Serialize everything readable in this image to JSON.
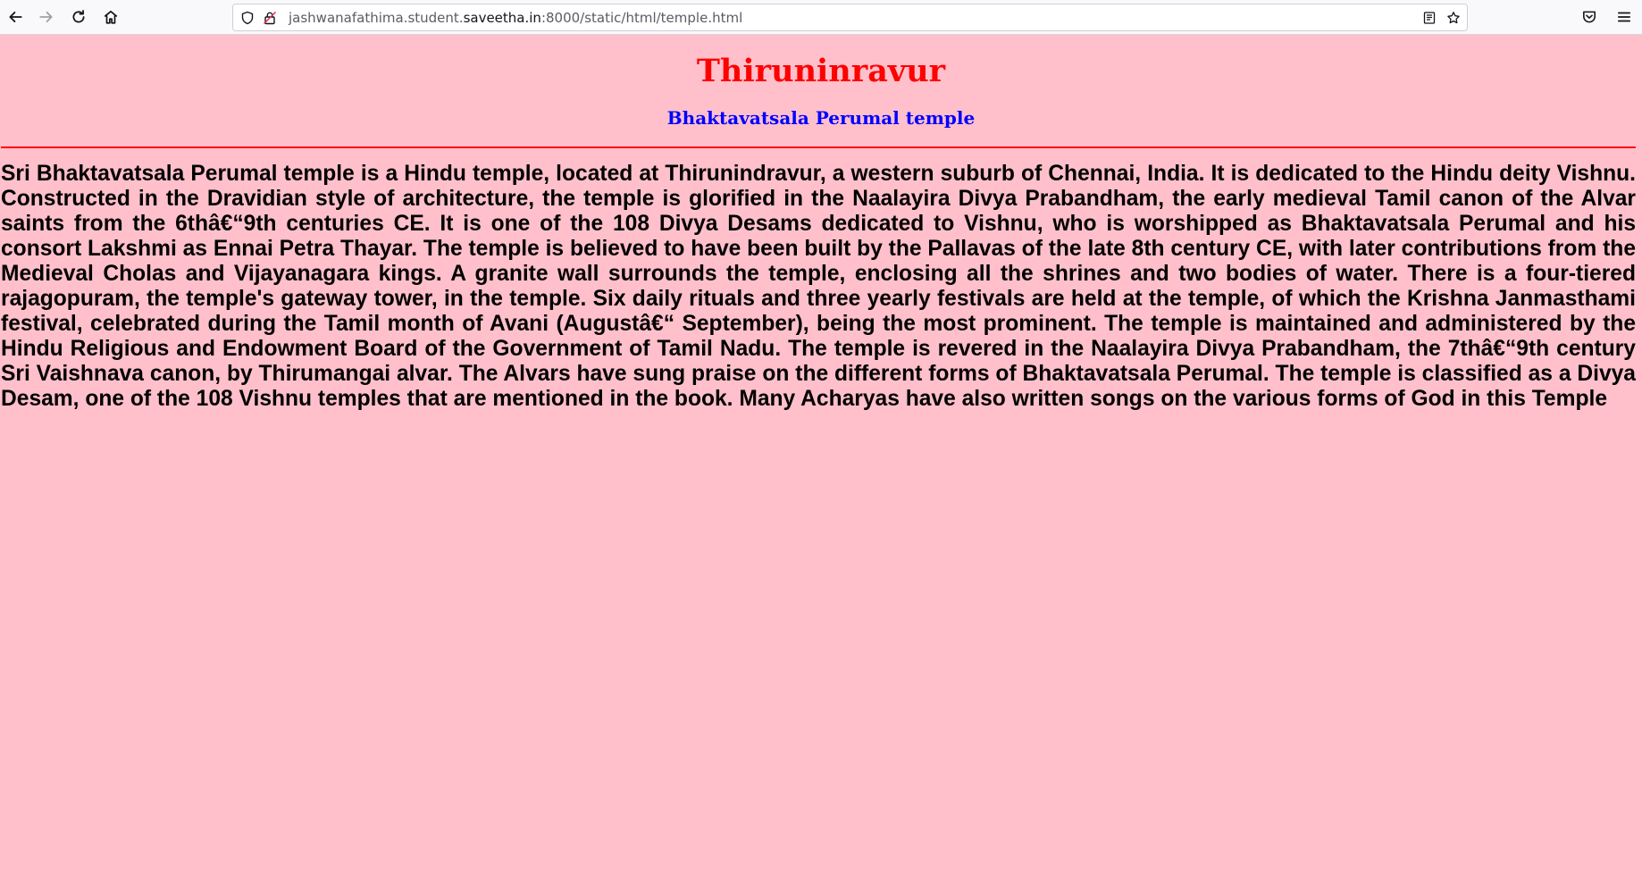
{
  "browser": {
    "url_prefix": "jashwanafathima.student.",
    "url_domain": "saveetha.in",
    "url_suffix": ":8000/static/html/temple.html"
  },
  "page": {
    "title": "Thiruninravur",
    "subtitle": "Bhaktavatsala Perumal temple",
    "paragraph": "Sri Bhaktavatsala Perumal temple is a Hindu temple, located at Thirunindravur, a western suburb of Chennai, India. It is dedicated to the Hindu deity Vishnu. Constructed in the Dravidian style of architecture, the temple is glorified in the Naalayira Divya Prabandham, the early medieval Tamil canon of the Alvar saints from the 6thâ€“9th centuries CE. It is one of the 108 Divya Desams dedicated to Vishnu, who is worshipped as Bhaktavatsala Perumal and his consort Lakshmi as Ennai Petra Thayar. The temple is believed to have been built by the Pallavas of the late 8th century CE, with later contributions from the Medieval Cholas and Vijayanagara kings. A granite wall surrounds the temple, enclosing all the shrines and two bodies of water. There is a four-tiered rajagopuram, the temple's gateway tower, in the temple. Six daily rituals and three yearly festivals are held at the temple, of which the Krishna Janmasthami festival, celebrated during the Tamil month of Avani (Augustâ€“ September), being the most prominent. The temple is maintained and administered by the Hindu Religious and Endowment Board of the Government of Tamil Nadu. The temple is revered in the Naalayira Divya Prabandham, the 7thâ€“9th century Sri Vaishnava canon, by Thirumangai alvar. The Alvars have sung praise on the different forms of Bhaktavatsala Perumal. The temple is classified as a Divya Desam, one of the 108 Vishnu temples that are mentioned in the book. Many Acharyas have also written songs on the various forms of God in this Temple"
  },
  "colors": {
    "background": "#ffc0cb",
    "title": "#ff0000",
    "subtitle": "#0000ff",
    "divider": "#ff0000"
  },
  "icons": [
    "back-arrow-icon",
    "forward-arrow-icon",
    "reload-icon",
    "home-icon",
    "shield-icon",
    "lock-insecure-icon",
    "reader-view-icon",
    "bookmark-star-icon",
    "pocket-icon",
    "menu-icon"
  ]
}
